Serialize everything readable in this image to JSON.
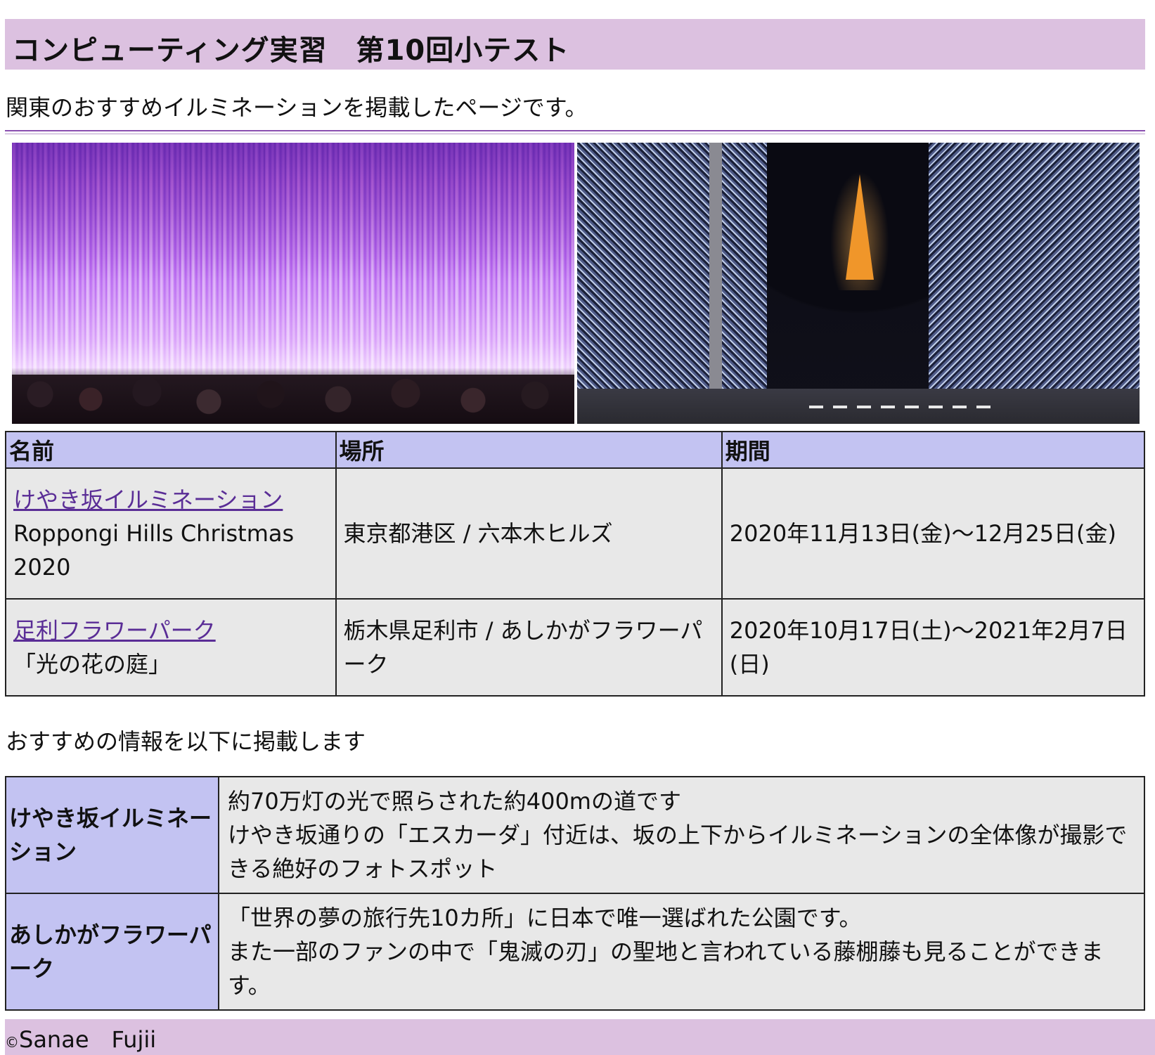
{
  "header": {
    "title": "コンピューティング実習　第10回小テスト"
  },
  "intro": "関東のおすすめイルミネーションを掲載したページです。",
  "images": [
    {
      "alt": "藤の花のライトアップ"
    },
    {
      "alt": "けやき坂イルミネーションと東京タワー"
    }
  ],
  "table": {
    "headers": [
      "名前",
      "場所",
      "期間"
    ],
    "rows": [
      {
        "name_link": "けやき坂イルミネーション",
        "name_sub": "Roppongi Hills Christmas 2020",
        "place": "東京都港区 / 六本木ヒルズ",
        "period": "2020年11月13日(金)〜12月25日(金)"
      },
      {
        "name_link": "足利フラワーパーク",
        "name_sub": "「光の花の庭」",
        "place": "栃木県足利市 / あしかがフラワーパーク",
        "period": "2020年10月17日(土)〜2021年2月7日(日)"
      }
    ]
  },
  "recommend": {
    "intro": "おすすめの情報を以下に掲載します",
    "rows": [
      {
        "name": "けやき坂イルミネーション",
        "line1": "約70万灯の光で照らされた約400mの道です",
        "line2": "けやき坂通りの「エスカーダ」付近は、坂の上下からイルミネーションの全体像が撮影できる絶好のフォトスポット"
      },
      {
        "name": "あしかがフラワーパーク",
        "line1": "「世界の夢の旅行先10カ所」に日本で唯一選ばれた公園です。",
        "line2": "また一部のファンの中で「鬼滅の刃」の聖地と言われている藤棚藤も見ることができます。"
      }
    ]
  },
  "footer": {
    "copyright_symbol": "©",
    "author": "Sanae　Fujii"
  },
  "colors": {
    "header_bg": "#dcc1e0",
    "table_header_bg": "#c3c3f2",
    "cell_bg": "#e8e8e8",
    "link": "#5a2d96"
  }
}
